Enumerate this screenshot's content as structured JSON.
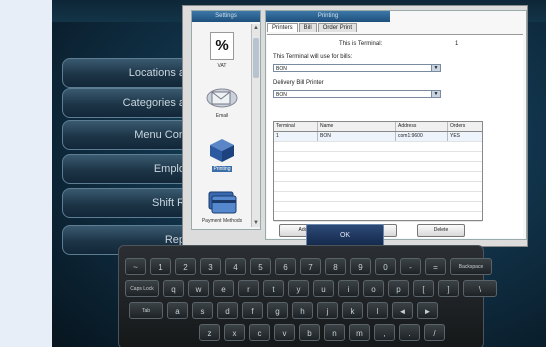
{
  "left_nav": [
    {
      "label": "Locations a"
    },
    {
      "label": "Categories a"
    },
    {
      "label": "Menu Con"
    },
    {
      "label": "Emplo"
    },
    {
      "label": "Shift R"
    },
    {
      "label": "Rep"
    }
  ],
  "settings": {
    "title": "Settings",
    "items": [
      {
        "label": "VAT",
        "icon": "percent-icon"
      },
      {
        "label": "Email",
        "icon": "email-icon"
      },
      {
        "label": "Printing",
        "icon": "cube-icon"
      },
      {
        "label": "Payment Methods",
        "icon": "payment-icon"
      }
    ]
  },
  "printing": {
    "title": "Printing",
    "tabs": [
      "Printers",
      "Bill",
      "Order Print"
    ],
    "active_tab": "Printers",
    "terminal_label": "This is Terminal:",
    "terminal_value": "1",
    "bill_printer_label": "This Terminal will use for bills:",
    "bill_printer_value": "BON",
    "delivery_label": "Delivery Bill Printer",
    "delivery_value": "BON",
    "table": {
      "columns": [
        "Terminal",
        "Name",
        "Address",
        "Orders"
      ],
      "rows": [
        [
          "1",
          "BON",
          "com1:9600",
          "YES"
        ]
      ]
    },
    "buttons": {
      "add": "Add",
      "edit": "Edit",
      "delete": "Delete"
    }
  },
  "ok_label": "OK",
  "keyboard": {
    "row1": [
      "~",
      "1",
      "2",
      "3",
      "4",
      "5",
      "6",
      "7",
      "8",
      "9",
      "0",
      "-",
      "=",
      "Backspace"
    ],
    "row2": [
      "Caps Lock",
      "q",
      "w",
      "e",
      "r",
      "t",
      "y",
      "u",
      "i",
      "o",
      "p",
      "[",
      "]",
      "\\"
    ],
    "row3": [
      "Tab",
      "a",
      "s",
      "d",
      "f",
      "g",
      "h",
      "j",
      "k",
      "l",
      "◄",
      "►"
    ],
    "row4": [
      "z",
      "x",
      "c",
      "v",
      "b",
      "n",
      "m",
      ",",
      ".",
      "/"
    ]
  }
}
